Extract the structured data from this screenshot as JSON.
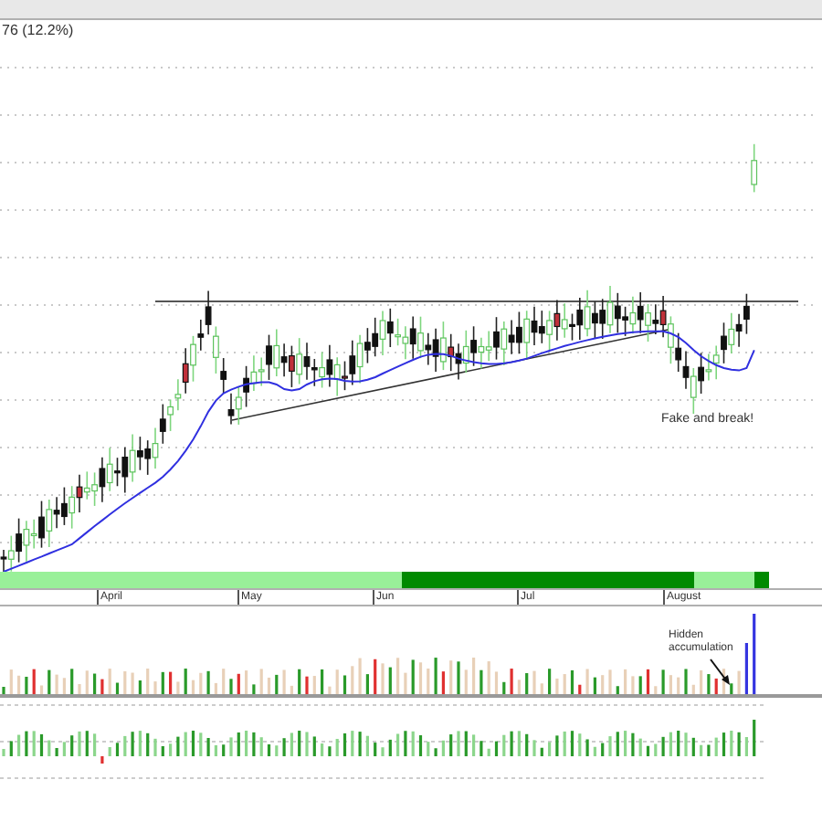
{
  "header": {
    "change": "76 (12.2%)"
  },
  "price_panel": {
    "annotation": "Fake and break!"
  },
  "time_axis": {
    "labels": [
      "April",
      "May",
      "Jun",
      "Jul",
      "August"
    ]
  },
  "volume_panel": {
    "annotation": "Hidden accumulation"
  }
}
